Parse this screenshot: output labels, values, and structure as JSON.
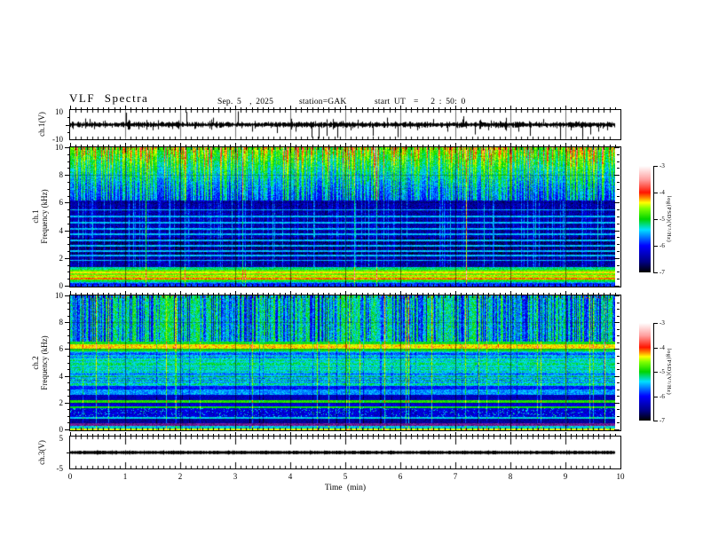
{
  "title": "VLF Spectra",
  "header": {
    "date": "Sep. 5  , 2025",
    "station": "station=GAK",
    "start_ut": "start UT  =   2 : 50: 0"
  },
  "axes": {
    "time": {
      "label": "Time  (min)",
      "min": 0,
      "max": 10,
      "major_ticks": [
        0,
        1,
        2,
        3,
        4,
        5,
        6,
        7,
        8,
        9,
        10
      ],
      "data_end_min": 9.9
    },
    "ch1v": {
      "label": "ch.1(V)",
      "min": -10,
      "max": 10,
      "tick_labels": [
        "10",
        "-10"
      ]
    },
    "ch1f": {
      "label_line1": "ch.1",
      "label_line2": "Frequency  (kHz)",
      "min": 0,
      "max": 10,
      "major_ticks": [
        0,
        2,
        4,
        6,
        8,
        10
      ]
    },
    "ch2f": {
      "label_line1": "ch.2",
      "label_line2": "Frequency  (kHz)",
      "min": 0,
      "max": 10,
      "major_ticks": [
        0,
        2,
        4,
        6,
        8,
        10
      ]
    },
    "ch3v": {
      "label": "ch.3(V)",
      "min": -5,
      "max": 5,
      "tick_labels": [
        "5",
        "-5"
      ]
    }
  },
  "colorbar": {
    "label": "log(PSD)(V²/Hz)",
    "min": -7,
    "max": -3,
    "ticks": [
      -3,
      -4,
      -5,
      -6,
      -7
    ]
  },
  "colormap": [
    [
      0.0,
      "#000000"
    ],
    [
      0.1,
      "#000085"
    ],
    [
      0.25,
      "#0000ff"
    ],
    [
      0.4,
      "#00e0ff"
    ],
    [
      0.5,
      "#00d400"
    ],
    [
      0.6,
      "#7fff00"
    ],
    [
      0.655,
      "#ffff00"
    ],
    [
      0.7,
      "#ff8800"
    ],
    [
      0.75,
      "#ff1500"
    ],
    [
      0.87,
      "#ff9e9e"
    ],
    [
      1.0,
      "#ffffff"
    ]
  ],
  "chart_data": [
    {
      "type": "line",
      "title": "ch.1(V) raw waveform",
      "xlabel": "Time (min)",
      "ylabel": "ch.1(V)",
      "xlim": [
        0,
        10
      ],
      "ylim": [
        -10,
        10
      ],
      "description": "continuous broadband noise of about ±1.5 V centred on 0 V for 0–9.9 min, with impulsive sferic spikes (mostly downward) reaching ±10 V",
      "spike_events": [
        [
          0.35,
          4
        ],
        [
          1.02,
          8.5
        ],
        [
          1.5,
          -4
        ],
        [
          2.12,
          9
        ],
        [
          2.6,
          5
        ],
        [
          3.05,
          9.5
        ],
        [
          3.3,
          -5
        ],
        [
          3.75,
          -6
        ],
        [
          4.1,
          -5
        ],
        [
          4.38,
          -9
        ],
        [
          4.52,
          -10
        ],
        [
          4.66,
          -8
        ],
        [
          4.85,
          -9.5
        ],
        [
          5.1,
          -4
        ],
        [
          5.5,
          -8
        ],
        [
          5.75,
          5
        ],
        [
          5.95,
          -9
        ],
        [
          6.3,
          -4
        ],
        [
          6.6,
          4
        ],
        [
          6.85,
          -5
        ],
        [
          7.15,
          6
        ],
        [
          7.35,
          -7
        ],
        [
          7.6,
          -4
        ],
        [
          7.9,
          -3.5
        ],
        [
          8.15,
          -5
        ],
        [
          8.35,
          -8
        ],
        [
          8.6,
          4
        ],
        [
          8.9,
          -9
        ],
        [
          9.1,
          -4
        ],
        [
          9.3,
          -8.5
        ],
        [
          9.45,
          -7
        ],
        [
          9.6,
          -5
        ],
        [
          9.75,
          -4
        ]
      ]
    },
    {
      "type": "heatmap",
      "title": "ch.1 VLF spectrogram",
      "xlabel": "Time (min)",
      "ylabel": "Frequency (kHz)",
      "zlabel": "log(PSD)(V²/Hz)",
      "xlim": [
        0,
        9.9
      ],
      "ylim": [
        0,
        10
      ],
      "zlim": [
        -7,
        -3
      ],
      "features": [
        "0–1.3 kHz: intense horizontal emission bands, PSD ≈ -4.2 to -4.8 (red/orange/yellow/green stripes)",
        "1.3–6.2 kHz: weak background ≈ -6.6 (dark blue/black) crossed by cyan vertical sferic streaks and thin cyan horizontal lines near 1.9, 2.2, 2.6, 2.9, 3.3, 3.8, 4.2, 4.6, 5.1 and 5.5 kHz",
        "6.2–10 kHz: green background ≈ -5.2 with dense vertical sferic streaks strengthening upward to -4 … -3.3 (yellow/red/pink) near 10 kHz"
      ]
    },
    {
      "type": "heatmap",
      "title": "ch.2 VLF spectrogram",
      "xlabel": "Time (min)",
      "ylabel": "Frequency (kHz)",
      "zlabel": "log(PSD)(V²/Hz)",
      "xlim": [
        0,
        9.9
      ],
      "ylim": [
        0,
        10
      ],
      "zlim": [
        -7,
        -3
      ],
      "features": [
        "strong narrowband line at ≈6.2 kHz, PSD ≈ -4.3 (yellow/orange with red blobs)",
        "6.6–10 kHz: cyan background with alternating green and dark-blue vertical streaks; orange flecks near 10 kHz",
        "2.6–6.0 kHz: green/cyan ≈ -5.4 with fine horizontal striations",
        "bright green lines at ≈2.1 and ≈1.65 kHz bordered by black lines; dark band 2.25–2.6 kHz",
        "cyan line ≈0.85 kHz, dark blue 0.5–0.8 kHz, purple band 0.3–0.5 kHz, red line at the bottom edge",
        "occasional full-height bright green/yellow sferic streaks"
      ]
    },
    {
      "type": "line",
      "title": "ch.3(V) raw waveform",
      "xlabel": "Time (min)",
      "ylabel": "ch.3(V)",
      "xlim": [
        0,
        10
      ],
      "ylim": [
        -5,
        5
      ],
      "description": "flat thick black trace at 0 V (no signal) from 0 to 9.9 min"
    }
  ],
  "render": {
    "spec1": {
      "seed": 11,
      "cyan_lines_khz": [
        1.85,
        2.2,
        2.55,
        2.9,
        3.3,
        3.75,
        4.15,
        4.6,
        5.05,
        5.5
      ],
      "low_bands": [
        [
          0.0,
          0.22,
          -5.9,
          0.5
        ],
        [
          0.22,
          0.3,
          -5.6,
          0.4
        ],
        [
          0.3,
          0.4,
          -5.1,
          0.4
        ],
        [
          0.4,
          0.5,
          -4.8,
          0.35
        ],
        [
          0.5,
          0.6,
          -4.15,
          0.3
        ],
        [
          0.6,
          0.72,
          -4.6,
          0.3
        ],
        [
          0.72,
          0.82,
          -4.25,
          0.3
        ],
        [
          0.82,
          0.95,
          -4.7,
          0.3
        ],
        [
          0.95,
          1.05,
          -4.35,
          0.3
        ],
        [
          1.05,
          1.2,
          -4.75,
          0.3
        ],
        [
          1.2,
          1.35,
          -5.2,
          0.35
        ]
      ]
    },
    "spec2": {
      "seed": 77,
      "bands": [
        {
          "f": [
            0.0,
            0.12
          ],
          "v": -4.45,
          "j": 0.3
        },
        {
          "f": [
            0.12,
            0.3
          ],
          "v": -5.4,
          "j": 0.5
        },
        {
          "f": [
            0.3,
            0.5
          ],
          "purple": true
        },
        {
          "f": [
            0.5,
            0.8
          ],
          "v": -6.5,
          "j": 0.4
        },
        {
          "f": [
            0.8,
            0.95
          ],
          "v": -5.4,
          "j": 0.35
        },
        {
          "f": [
            0.95,
            1.6
          ],
          "v": -6.2,
          "j": 0.5,
          "speck": 0.1
        },
        {
          "f": [
            1.6,
            1.75
          ],
          "v": -5.0,
          "j": 0.3
        },
        {
          "f": [
            1.75,
            2.0
          ],
          "v": -6.2,
          "j": 0.45
        },
        {
          "f": [
            2.0,
            2.05
          ],
          "v": -6.95,
          "j": 0.1
        },
        {
          "f": [
            2.05,
            2.2
          ],
          "v": -4.9,
          "j": 0.3
        },
        {
          "f": [
            2.2,
            2.25
          ],
          "v": -6.95,
          "j": 0.1
        },
        {
          "f": [
            2.25,
            2.6
          ],
          "v": -6.35,
          "j": 0.4
        },
        {
          "f": [
            2.6,
            3.0
          ],
          "v": -5.6,
          "j": 0.5
        },
        {
          "f": [
            3.0,
            3.25
          ],
          "v": -5.95,
          "j": 0.4
        },
        {
          "f": [
            3.25,
            4.4
          ],
          "v": -5.45,
          "j": 0.55,
          "stri": 0.25
        },
        {
          "f": [
            4.4,
            5.35
          ],
          "v": -5.3,
          "j": 0.5,
          "stri": 0.15
        },
        {
          "f": [
            5.35,
            5.85
          ],
          "v": -5.55,
          "j": 0.5,
          "stri": 0.25
        },
        {
          "f": [
            5.85,
            6.05
          ],
          "v": -5.0,
          "j": 0.4
        },
        {
          "f": [
            6.05,
            6.4
          ],
          "v": -4.35,
          "j": 0.35,
          "blob": 0.05
        },
        {
          "f": [
            6.4,
            6.6
          ],
          "v": -5.0,
          "j": 0.4
        },
        {
          "f": [
            6.6,
            10.01
          ],
          "v": -5.45,
          "j": 0.7,
          "streaky": true
        }
      ]
    },
    "ch1_waveform": {
      "seed": 5
    },
    "ch3_waveform": {
      "seed": 9
    }
  }
}
